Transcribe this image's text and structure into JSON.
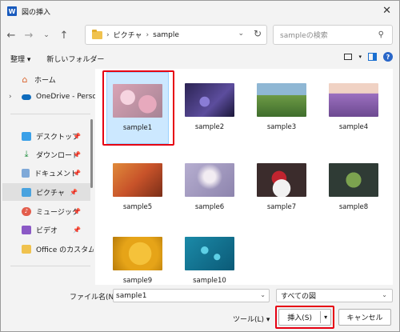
{
  "window": {
    "title": "図の挿入",
    "app_icon": "W"
  },
  "nav": {
    "path_segments": [
      "ピクチャ",
      "sample"
    ]
  },
  "search": {
    "placeholder": "sampleの検索"
  },
  "toolbar": {
    "organize": "整理 ▾",
    "new_folder": "新しいフォルダー"
  },
  "sidebar": {
    "items": [
      {
        "label": "ホーム",
        "icon": "home-icon"
      },
      {
        "label": "OneDrive - Perso",
        "icon": "onedrive-icon"
      },
      {
        "label": "デスクトップ",
        "icon": "desktop-icon"
      },
      {
        "label": "ダウンロード",
        "icon": "download-icon"
      },
      {
        "label": "ドキュメント",
        "icon": "document-icon"
      },
      {
        "label": "ピクチャ",
        "icon": "pictures-icon"
      },
      {
        "label": "ミュージック",
        "icon": "music-icon"
      },
      {
        "label": "ビデオ",
        "icon": "video-icon"
      },
      {
        "label": "Office のカスタム",
        "icon": "folder-icon"
      }
    ]
  },
  "files": [
    {
      "name": "sample1",
      "theme": "cherry blossoms",
      "colors": [
        "#d9a3b5",
        "#f0c6d4",
        "#a78495"
      ]
    },
    {
      "name": "sample2",
      "theme": "purple night flower",
      "colors": [
        "#2b2353",
        "#5c4d9d",
        "#1a1638"
      ]
    },
    {
      "name": "sample3",
      "theme": "green valley",
      "colors": [
        "#8fb7d4",
        "#5d8b3a",
        "#3f6d2c"
      ]
    },
    {
      "name": "sample4",
      "theme": "lavender field",
      "colors": [
        "#f0d2c4",
        "#9b6fbf",
        "#6d4a91"
      ]
    },
    {
      "name": "sample5",
      "theme": "autumn forest",
      "colors": [
        "#c8532a",
        "#e08a3a",
        "#7a2e18"
      ]
    },
    {
      "name": "sample6",
      "theme": "bokeh lights",
      "colors": [
        "#b6aed0",
        "#e6dde8",
        "#8d84ad"
      ]
    },
    {
      "name": "sample7",
      "theme": "strawberries",
      "colors": [
        "#3b2c2c",
        "#c0242f",
        "#f2f2f2"
      ]
    },
    {
      "name": "sample8",
      "theme": "herbs on dark",
      "colors": [
        "#2f3b35",
        "#7ca24f",
        "#1c2520"
      ]
    },
    {
      "name": "sample9",
      "theme": "yellow rose",
      "colors": [
        "#f5c23a",
        "#e6a418",
        "#b77b0a"
      ]
    },
    {
      "name": "sample10",
      "theme": "water drops",
      "colors": [
        "#1b8aa8",
        "#5ed0e6",
        "#0b5a77"
      ]
    }
  ],
  "selected_file": "sample1",
  "footer": {
    "filename_label": "ファイル名(N):",
    "filename_value": "sample1",
    "filetype_value": "すべての図",
    "tools": "ツール(L) ▾",
    "insert": "挿入(S)",
    "cancel": "キャンセル"
  },
  "colors": {
    "highlight": "#e60012",
    "selection": "#cce8ff"
  }
}
